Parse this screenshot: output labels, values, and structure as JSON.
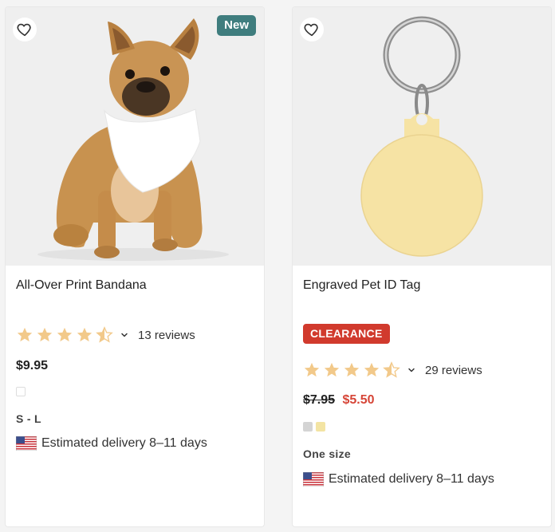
{
  "colors": {
    "accent_teal": "#3f7d7e",
    "clearance_red": "#d13a2d",
    "sale_price_red": "#d64537",
    "star_gold": "#f2c98a"
  },
  "products": [
    {
      "badge": "New",
      "title": "All-Over Print Bandana",
      "rating": 4.5,
      "reviews": "13 reviews",
      "price": "$9.95",
      "swatches": [
        "#ffffff"
      ],
      "size": "S - L",
      "delivery": "Estimated delivery 8–11 days",
      "icons": {
        "favorite": "heart-outline-icon",
        "flag": "us-flag-icon"
      }
    },
    {
      "tag": "CLEARANCE",
      "title": "Engraved Pet ID Tag",
      "rating": 4.5,
      "reviews": "29 reviews",
      "old_price": "$7.95",
      "sale_price": "$5.50",
      "swatches": [
        "#d4d4d4",
        "#f3e4a3"
      ],
      "size": "One size",
      "delivery": "Estimated delivery 8–11 days",
      "icons": {
        "favorite": "heart-outline-icon",
        "flag": "us-flag-icon"
      }
    }
  ]
}
